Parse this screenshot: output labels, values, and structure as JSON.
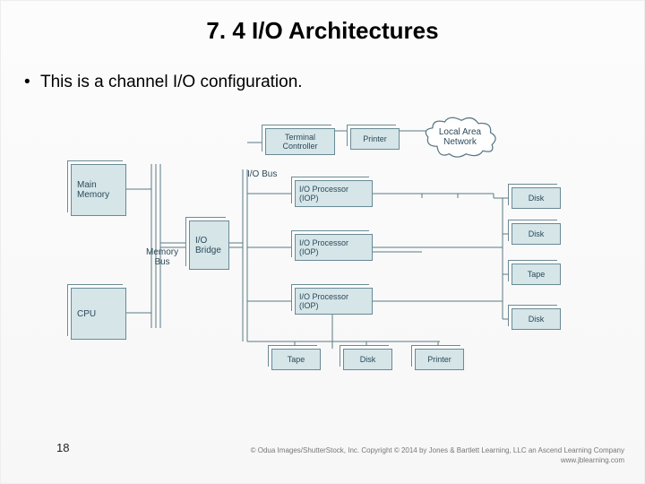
{
  "title": "7. 4 I/O Architectures",
  "bullet": "This is a channel I/O configuration.",
  "labels": {
    "memory_bus": "Memory\nBus",
    "io_bus": "I/O Bus"
  },
  "boxes": {
    "main_memory": "Main\nMemory",
    "cpu": "CPU",
    "io_bridge": "I/O\nBridge",
    "terminal_controller": "Terminal\nController",
    "printer_top": "Printer",
    "lan": "Local Area\nNetwork",
    "iop1": "I/O Processor\n(IOP)",
    "iop2": "I/O Processor\n(IOP)",
    "iop3": "I/O Processor\n(IOP)",
    "disk_r1": "Disk",
    "disk_r2": "Disk",
    "tape_r": "Tape",
    "disk_r3": "Disk",
    "tape_b": "Tape",
    "disk_b": "Disk",
    "printer_b": "Printer"
  },
  "page_number": "18",
  "copyright_line1": "© Odua Images/ShutterStock, Inc. Copyright © 2014 by Jones & Bartlett Learning, LLC an Ascend Learning Company",
  "copyright_line2": "www.jblearning.com"
}
